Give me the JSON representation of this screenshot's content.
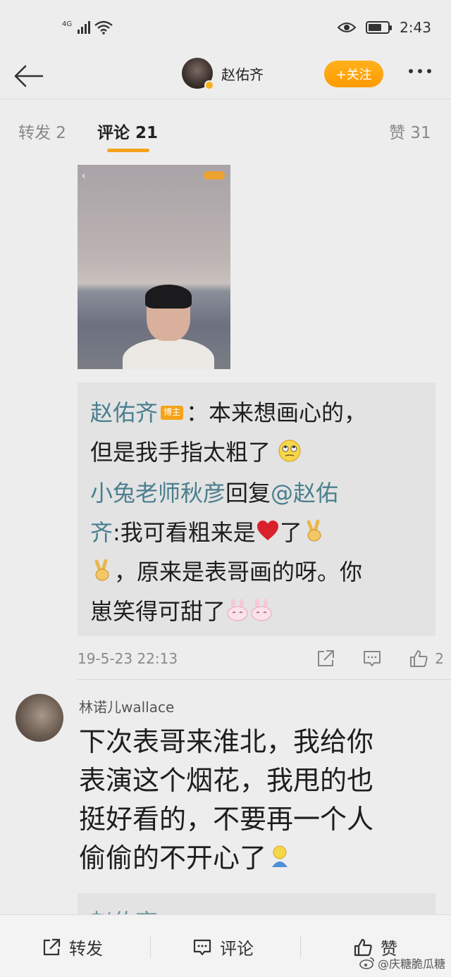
{
  "status_bar": {
    "network": "4G",
    "time": "2:43"
  },
  "header": {
    "user_name": "赵佑齐",
    "follow_label": "+关注"
  },
  "tabs": [
    {
      "label": "转发 2"
    },
    {
      "label": "评论 21"
    },
    {
      "label": "赞 31"
    }
  ],
  "quoted_thread": {
    "line1_user": "赵佑齐",
    "line1_badge": "博主",
    "line1_text": "：本来想画心的，",
    "line2_text": "但是我手指太粗了",
    "line3_user": "小兔老师秋彦",
    "line3_reply": "回复",
    "line3_mention": "@赵佑",
    "line4_mention": "齐",
    "line4_text": ":我可看粗来是",
    "line4_tail": "了",
    "line5_text": "，原来是表哥画的呀。你",
    "line6_text": "崽笑得可甜了"
  },
  "comment_meta": {
    "timestamp": "19-5-23 22:13",
    "like_count": "2"
  },
  "comment": {
    "author": "林诺儿wallace",
    "lines": [
      "下次表哥来淮北，我给你",
      "表演这个烟花，我甩的也",
      "挺好看的，不要再一个人",
      "偷偷的不开心了"
    ]
  },
  "partial_next": "赵佑齐",
  "bottom_bar": {
    "repost": "转发",
    "comment": "评论",
    "like": "赞"
  },
  "watermark": "@庆糖脆瓜糖",
  "colors": {
    "accent": "#f6a21a",
    "link": "#4a7f8e",
    "background": "#ededed"
  }
}
